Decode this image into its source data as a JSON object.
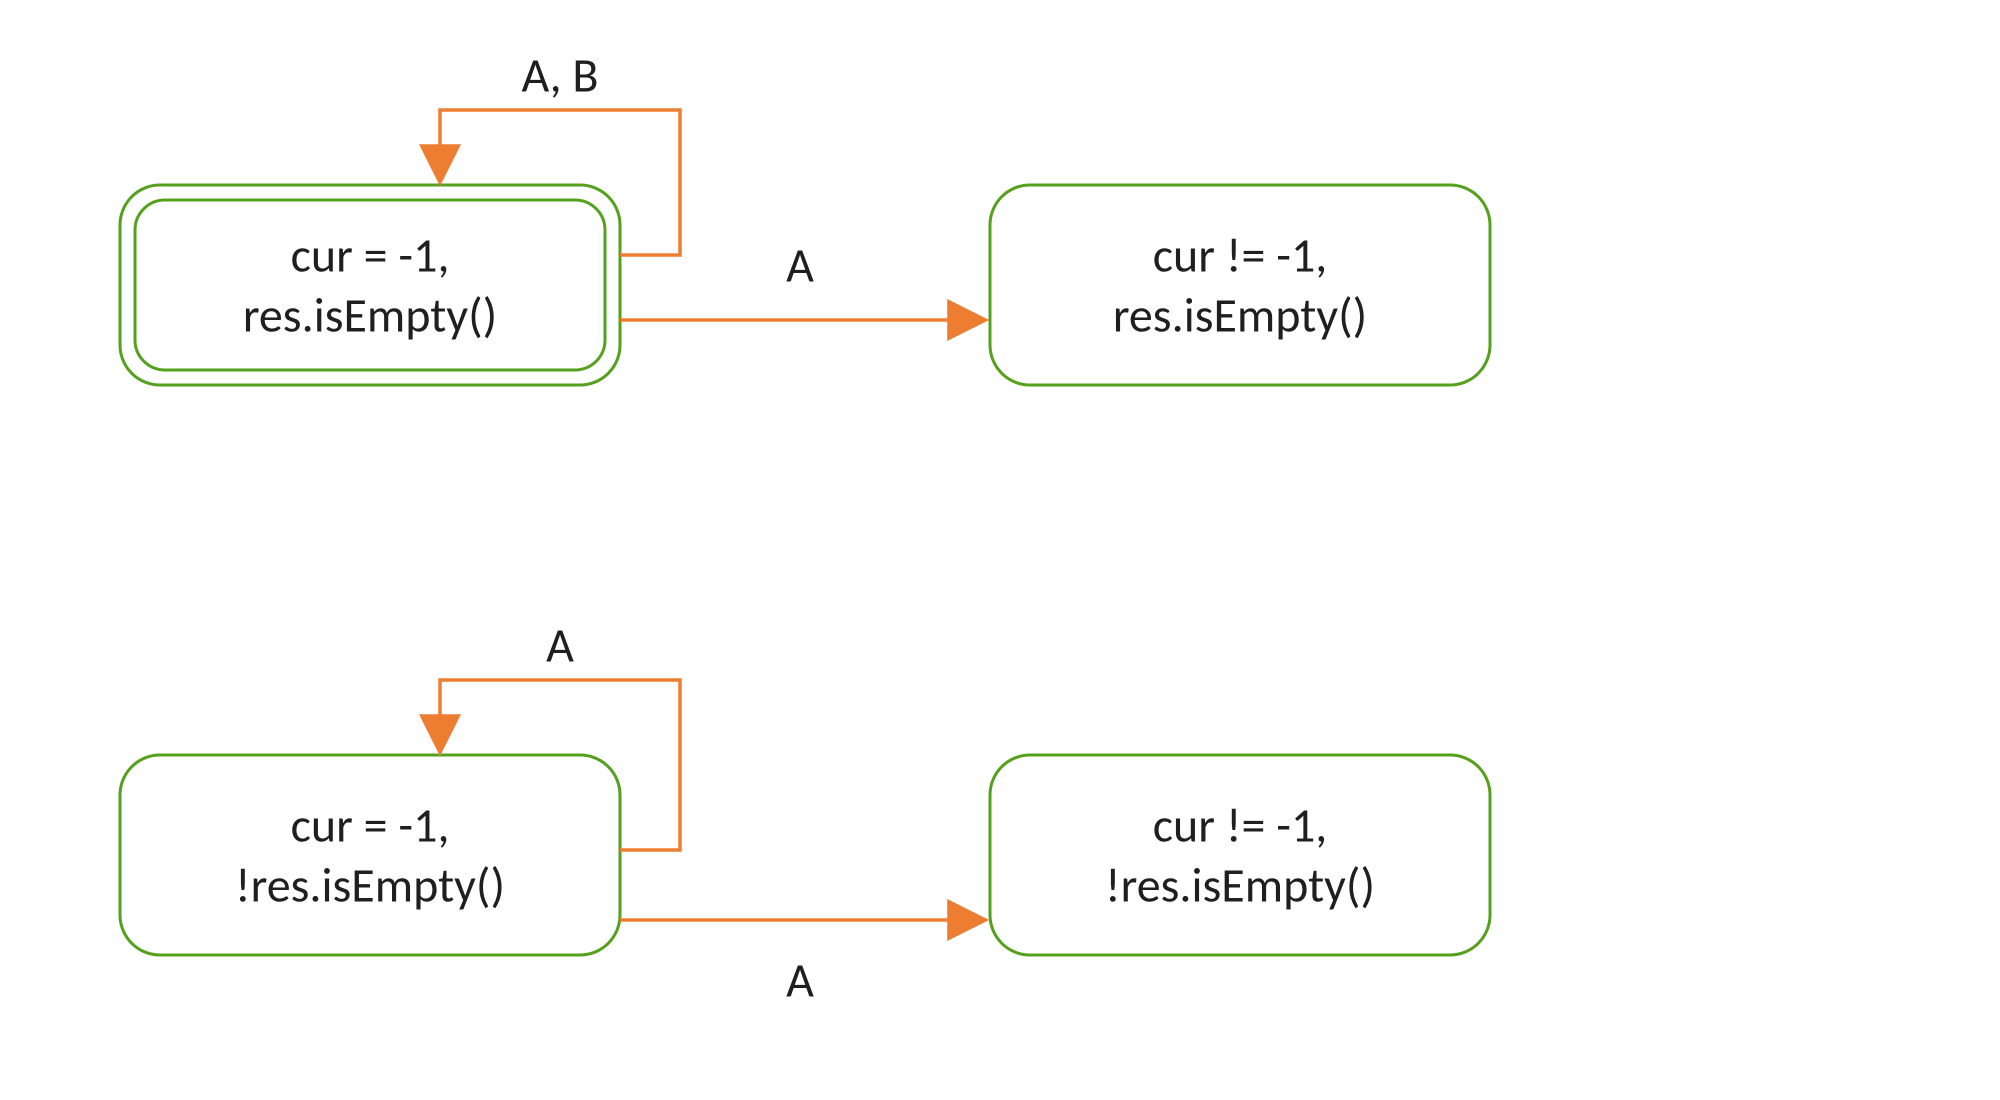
{
  "nodes": {
    "top_left": {
      "line1": "cur = -1,",
      "line2": "res.isEmpty()",
      "double_border": true
    },
    "top_right": {
      "line1": "cur != -1,",
      "line2": "res.isEmpty()",
      "double_border": false
    },
    "bottom_left": {
      "line1": "cur = -1,",
      "line2": "!res.isEmpty()",
      "double_border": false
    },
    "bottom_right": {
      "line1": "cur != -1,",
      "line2": "!res.isEmpty()",
      "double_border": false
    }
  },
  "edges": {
    "top_self_loop_label": "A, B",
    "top_transition_label": "A",
    "bottom_self_loop_label": "A",
    "bottom_transition_label": "A"
  },
  "colors": {
    "node_stroke": "#55a11e",
    "edge_stroke": "#ed7d31",
    "text": "#1f1f1f"
  }
}
